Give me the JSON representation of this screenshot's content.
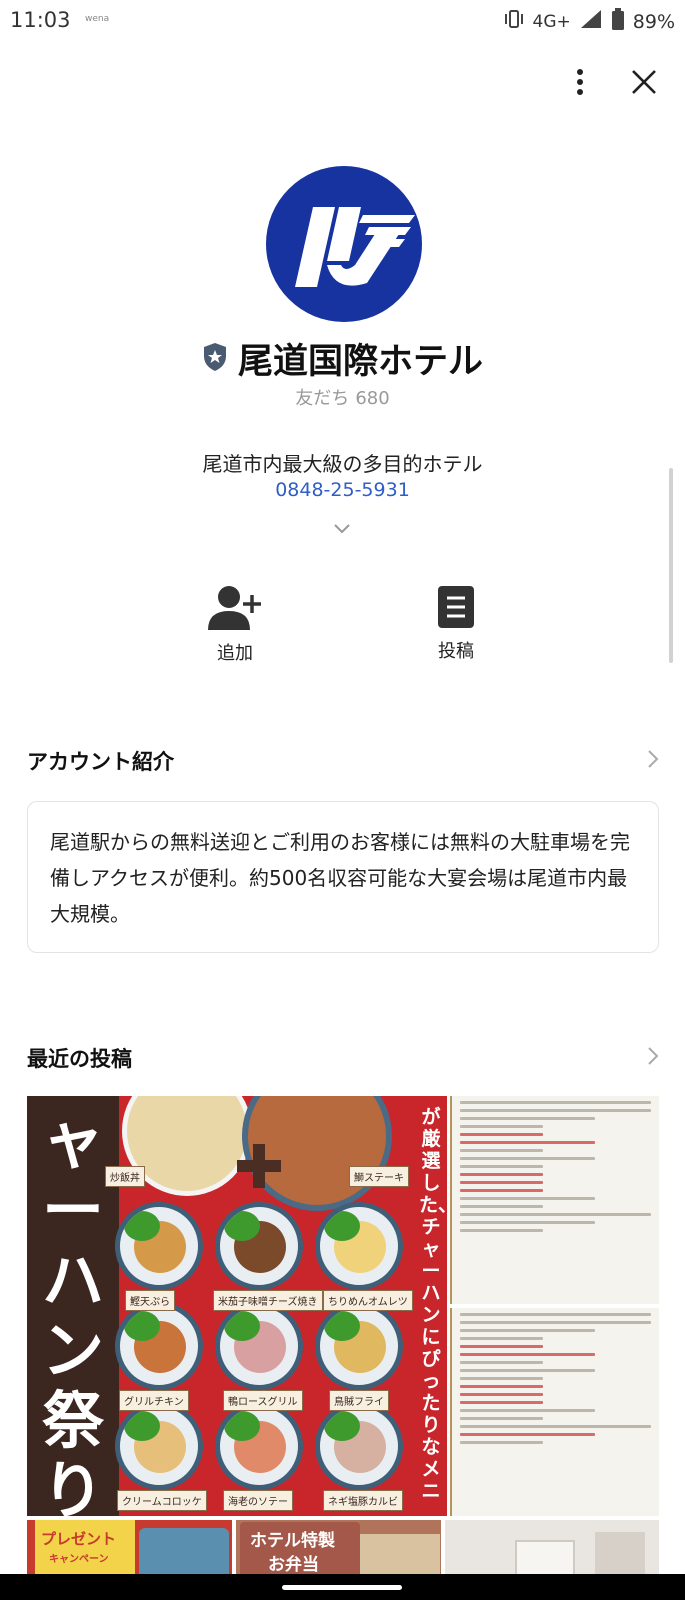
{
  "status_bar": {
    "time": "11:03",
    "carrier_note": "wena",
    "network": "4G+",
    "battery": "89%",
    "icons": [
      "vibrate-icon",
      "signal-icon",
      "battery-icon"
    ]
  },
  "header": {
    "more_icon": "more-vertical-icon",
    "close_icon": "close-icon"
  },
  "profile": {
    "logo_icon": "hotel-logo",
    "brand_color": "#1633a0",
    "badge_icon": "verified-shield-icon",
    "name": "尾道国際ホテル",
    "friends_label": "友だち",
    "friends_count": "680",
    "tagline": "尾道市内最大級の多目的ホテル",
    "phone": "0848-25-5931",
    "link_color": "#2e5ec7",
    "expand_icon": "chevron-down-icon"
  },
  "actions": [
    {
      "label": "追加",
      "icon": "add-friend-icon"
    },
    {
      "label": "投稿",
      "icon": "post-icon"
    }
  ],
  "about": {
    "title": "アカウント紹介",
    "text": "尾道駅からの無料送迎とご利用のお客様には無料の大駐車場を完備しアクセスが便利。約500名収容可能な大宴会場は尾道市内最大規模。"
  },
  "recent": {
    "title": "最近の投稿",
    "main_post": {
      "headline": "ャーハン祭り",
      "side_text": "が厳選した、チャーハンにぴったりなメニ",
      "top_labels": [
        "炒飯丼",
        "鰤ステーキ"
      ],
      "dish_labels": [
        "鰹天ぷら",
        "米茄子味噌チーズ焼き",
        "ちりめんオムレツ",
        "グリルチキン",
        "鴨ロースグリル",
        "鳥賊フライ",
        "クリームコロッケ",
        "海老のソテー",
        "ネギ塩豚カルビ"
      ]
    },
    "thumbnails": [
      {
        "text_line1": "プレゼント",
        "text_line2": "キャンペーン"
      },
      {
        "text_line1": "ホテル特製",
        "text_line2": "お弁当"
      },
      {
        "text_line1": "",
        "text_line2": ""
      }
    ]
  }
}
